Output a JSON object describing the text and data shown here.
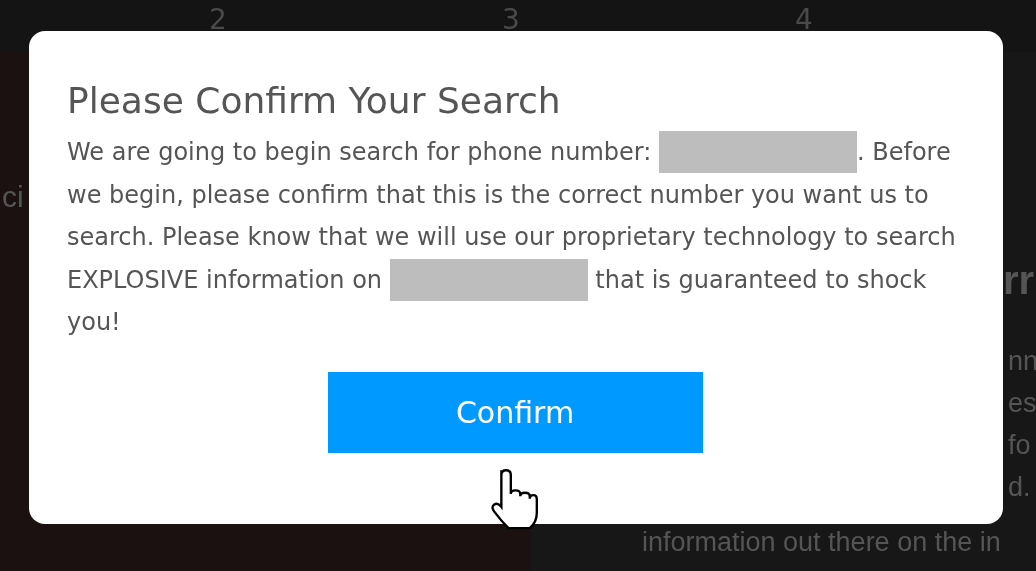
{
  "background": {
    "steps": [
      "2",
      "3",
      "4"
    ],
    "fragments": [
      {
        "kind": "left",
        "text": "ci"
      },
      {
        "kind": "heading",
        "text": "rr"
      },
      {
        "kind": "line",
        "text": "nn"
      },
      {
        "kind": "line",
        "text": "es"
      },
      {
        "kind": "line",
        "text": "fo"
      },
      {
        "kind": "line",
        "text": "d."
      },
      {
        "kind": "bottom",
        "text": "information out there on the in"
      }
    ]
  },
  "dialog": {
    "title": "Please Confirm Your Search",
    "message": [
      {
        "kind": "text",
        "text": "We are going to begin search for phone number: "
      },
      {
        "kind": "redacted"
      },
      {
        "kind": "text",
        "text": ". Before we begin, please confirm that this is the correct number you want us to search. Please know that we will use our proprietary technology to search EXPLOSIVE information on "
      },
      {
        "kind": "redacted"
      },
      {
        "kind": "text",
        "text": " that is guaranteed to shock you!"
      }
    ],
    "button": "Confirm"
  }
}
